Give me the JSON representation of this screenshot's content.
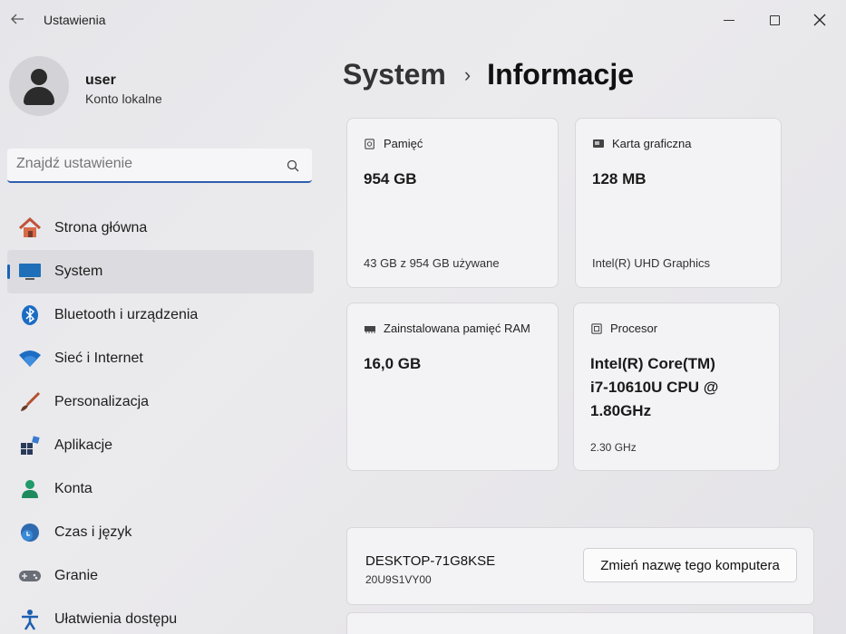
{
  "window": {
    "title": "Ustawienia"
  },
  "user": {
    "name": "user",
    "account_type": "Konto lokalne"
  },
  "search": {
    "placeholder": "Znajdź ustawienie"
  },
  "nav": [
    {
      "label": "Strona główna",
      "icon": "home-icon"
    },
    {
      "label": "System",
      "icon": "system-icon",
      "active": true
    },
    {
      "label": "Bluetooth i urządzenia",
      "icon": "bluetooth-icon"
    },
    {
      "label": "Sieć i Internet",
      "icon": "wifi-icon"
    },
    {
      "label": "Personalizacja",
      "icon": "brush-icon"
    },
    {
      "label": "Aplikacje",
      "icon": "apps-icon"
    },
    {
      "label": "Konta",
      "icon": "account-icon"
    },
    {
      "label": "Czas i język",
      "icon": "time-language-icon"
    },
    {
      "label": "Granie",
      "icon": "gamepad-icon"
    },
    {
      "label": "Ułatwienia dostępu",
      "icon": "accessibility-icon"
    }
  ],
  "breadcrumb": {
    "root": "System",
    "separator": "›",
    "current": "Informacje"
  },
  "cards": {
    "storage": {
      "title": "Pamięć",
      "value": "954 GB",
      "detail": "43 GB z 954 GB używane"
    },
    "gpu": {
      "title": "Karta graficzna",
      "value": "128 MB",
      "detail": "Intel(R) UHD Graphics"
    },
    "ram": {
      "title": "Zainstalowana pamięć RAM",
      "value": "16,0 GB"
    },
    "cpu": {
      "title": "Procesor",
      "value_lines": [
        "Intel(R) Core(TM)",
        "i7-10610U CPU @",
        "1.80GHz"
      ],
      "detail": "2.30 GHz"
    }
  },
  "device": {
    "name": "DESKTOP-71G8KSE",
    "model": "20U9S1VY00",
    "rename_label": "Zmień nazwę tego komputera"
  },
  "colors": {
    "accent": "#1a64b8"
  }
}
